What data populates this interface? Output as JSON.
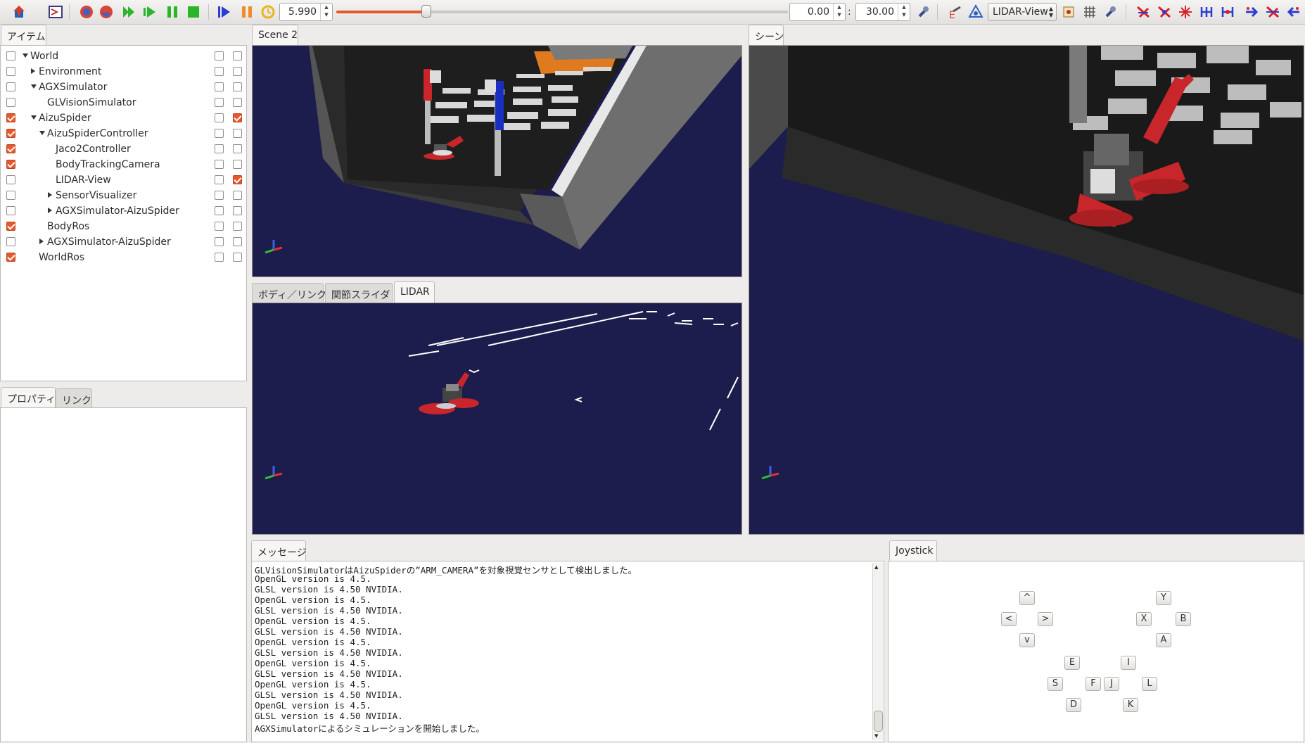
{
  "toolbar": {
    "time_value": "5.990",
    "slider_fraction": 0.2,
    "range_start": "0.00",
    "range_sep": ":",
    "range_end": "30.00",
    "camera_select": "LIDAR-View"
  },
  "items_panel": {
    "tab": "アイテム",
    "tree": [
      {
        "label": "World",
        "level": 0,
        "expander": "down",
        "checked": false,
        "c1": false,
        "c2": false
      },
      {
        "label": "Environment",
        "level": 1,
        "expander": "right",
        "checked": false,
        "c1": false,
        "c2": false
      },
      {
        "label": "AGXSimulator",
        "level": 1,
        "expander": "down",
        "checked": false,
        "c1": false,
        "c2": false
      },
      {
        "label": "GLVisionSimulator",
        "level": 2,
        "expander": "",
        "checked": false,
        "c1": false,
        "c2": false
      },
      {
        "label": "AizuSpider",
        "level": 1,
        "expander": "down",
        "checked": true,
        "c1": false,
        "c2": true
      },
      {
        "label": "AizuSpiderController",
        "level": 2,
        "expander": "down",
        "checked": true,
        "c1": false,
        "c2": false
      },
      {
        "label": "Jaco2Controller",
        "level": 3,
        "expander": "",
        "checked": true,
        "c1": false,
        "c2": false
      },
      {
        "label": "BodyTrackingCamera",
        "level": 3,
        "expander": "",
        "checked": true,
        "c1": false,
        "c2": false
      },
      {
        "label": "LIDAR-View",
        "level": 3,
        "expander": "",
        "checked": false,
        "c1": false,
        "c2": true
      },
      {
        "label": "SensorVisualizer",
        "level": 3,
        "expander": "right",
        "checked": false,
        "c1": false,
        "c2": false
      },
      {
        "label": "AGXSimulator-AizuSpider",
        "level": 3,
        "expander": "right",
        "checked": false,
        "c1": false,
        "c2": false
      },
      {
        "label": "BodyRos",
        "level": 2,
        "expander": "",
        "checked": true,
        "c1": false,
        "c2": false
      },
      {
        "label": "AGXSimulator-AizuSpider",
        "level": 2,
        "expander": "right",
        "checked": false,
        "c1": false,
        "c2": false
      },
      {
        "label": "WorldRos",
        "level": 1,
        "expander": "",
        "checked": true,
        "c1": false,
        "c2": false
      }
    ]
  },
  "property_panel": {
    "tabs": [
      "プロパティ",
      "リンク"
    ]
  },
  "scene2_panel": {
    "tab": "Scene 2"
  },
  "scene_panel": {
    "tab": "シーン"
  },
  "lidar_panel": {
    "tabs": [
      "ボディ／リンク",
      "関節スライダ",
      "LIDAR"
    ]
  },
  "message_panel": {
    "tab": "メッセージ",
    "lines": [
      "GLVisionSimulatorはAizuSpiderの”ARM_CAMERA”を対象視覚センサとして検出しました。",
      "OpenGL version is 4.5.",
      "GLSL version is 4.50 NVIDIA.",
      "OpenGL version is 4.5.",
      "GLSL version is 4.50 NVIDIA.",
      "OpenGL version is 4.5.",
      "GLSL version is 4.50 NVIDIA.",
      "OpenGL version is 4.5.",
      "GLSL version is 4.50 NVIDIA.",
      "OpenGL version is 4.5.",
      "GLSL version is 4.50 NVIDIA.",
      "OpenGL version is 4.5.",
      "GLSL version is 4.50 NVIDIA.",
      "OpenGL version is 4.5.",
      "GLSL version is 4.50 NVIDIA.",
      "AGXSimulatorによるシミュレーションを開始しました。"
    ]
  },
  "joystick_panel": {
    "tab": "Joystick",
    "buttons": {
      "up": "^",
      "left": "<",
      "right": ">",
      "down": "v",
      "y": "Y",
      "x": "X",
      "b": "B",
      "a": "A",
      "e": "E",
      "i": "I",
      "s": "S",
      "f": "F",
      "j": "J",
      "l": "L",
      "d": "D",
      "k": "K"
    }
  },
  "colors": {
    "viewport_bg": "#1c1c4d",
    "accent": "#e9572b"
  }
}
